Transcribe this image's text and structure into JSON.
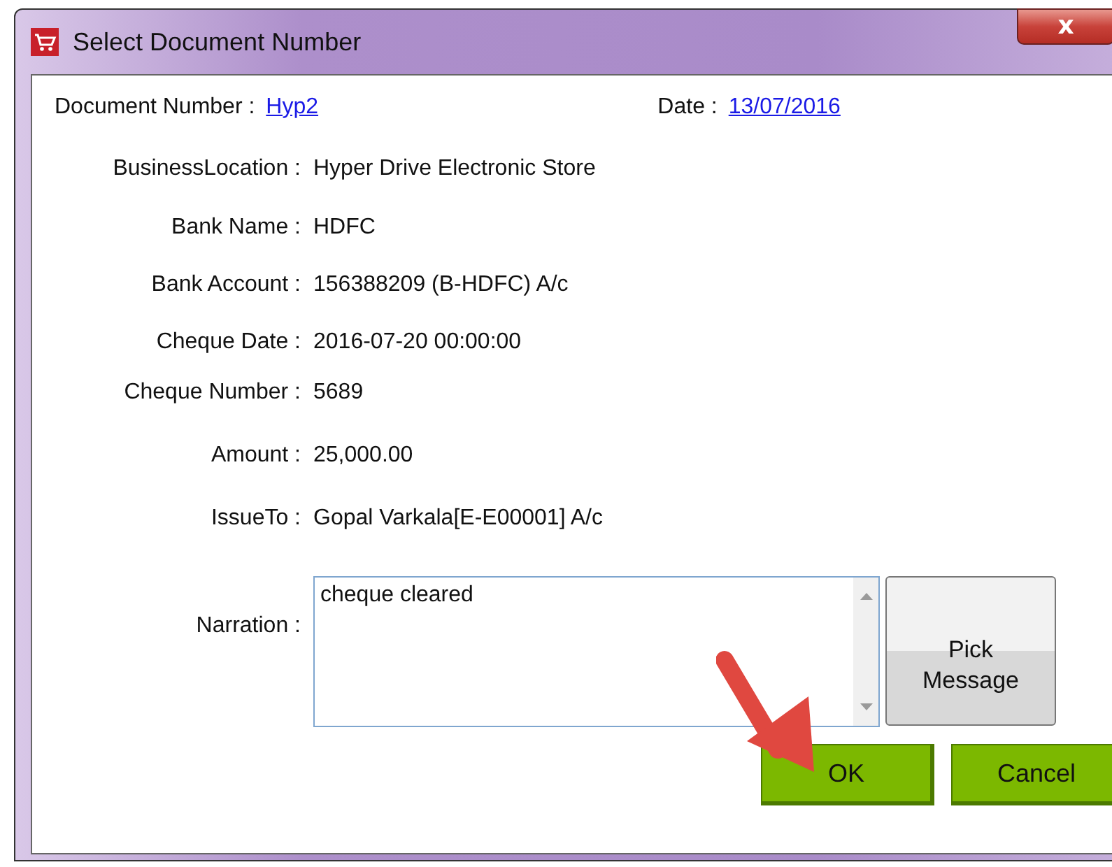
{
  "window": {
    "title": "Select Document Number",
    "close": "x"
  },
  "header": [
    {
      "label": "Document Number :",
      "value": "Hyp2"
    },
    {
      "label": "Date :",
      "value": "13/07/2016"
    }
  ],
  "fields": [
    {
      "label": "BusinessLocation :",
      "value": "Hyper Drive Electronic Store"
    },
    {
      "label": "Bank Name :",
      "value": "HDFC"
    },
    {
      "label": "Bank Account :",
      "value": "156388209 (B-HDFC) A/c"
    },
    {
      "label": "Cheque Date :",
      "value": "2016-07-20 00:00:00"
    },
    {
      "label": "Cheque Number :",
      "value": "5689"
    },
    {
      "label": "Amount :",
      "value": "25,000.00"
    },
    {
      "label": "IssueTo :",
      "value": "Gopal Varkala[E-E00001] A/c"
    }
  ],
  "narration": {
    "label": "Narration :",
    "value": "cheque cleared"
  },
  "pick_button": "Pick Message",
  "buttons": [
    "OK",
    "Cancel"
  ]
}
